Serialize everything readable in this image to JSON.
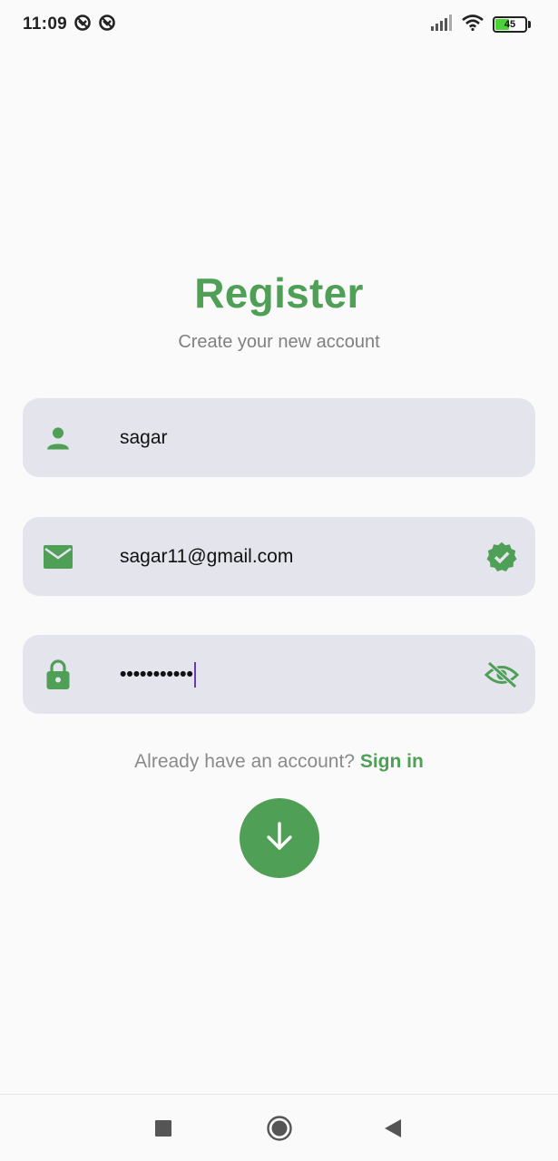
{
  "status_bar": {
    "time": "11:09",
    "battery_level": "45",
    "battery_fraction": 0.45,
    "icons": [
      "notification-icon",
      "notification-icon",
      "signal-icon",
      "wifi-icon",
      "battery-icon"
    ]
  },
  "header": {
    "title": "Register",
    "subtitle": "Create your new account"
  },
  "form": {
    "username": {
      "icon": "person-icon",
      "value": "sagar"
    },
    "email": {
      "icon": "mail-icon",
      "value": "sagar11@gmail.com",
      "trailing_icon": "verified-check-icon"
    },
    "password": {
      "icon": "lock-icon",
      "masked_value": "•••••••••••",
      "trailing_icon": "visibility-off-icon"
    }
  },
  "signin": {
    "prompt": "Already have an account?",
    "link": "Sign in"
  },
  "fab": {
    "icon": "arrow-down-icon"
  },
  "nav_bar": {
    "icons": [
      "recents-square-icon",
      "home-circle-icon",
      "back-triangle-icon"
    ]
  },
  "colors": {
    "accent": "#4f9f56",
    "field_bg": "#e3e4ec",
    "background": "#fafafa",
    "cursor": "#6a3bb5"
  }
}
